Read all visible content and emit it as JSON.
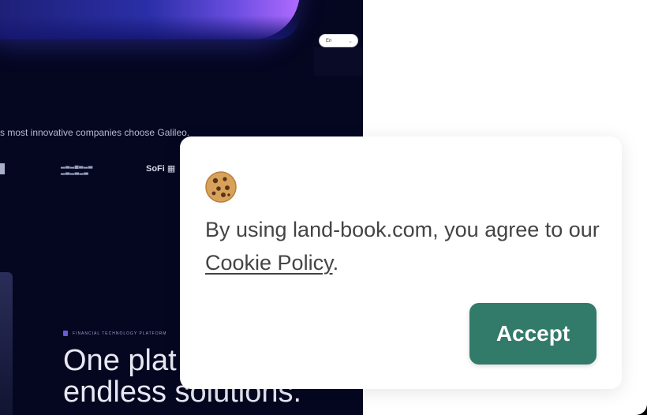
{
  "background_preview": {
    "language": "En",
    "tagline": "s most innovative companies choose Galileo.",
    "logos": [
      "SoFi"
    ],
    "kicker": "FINANCIAL TECHNOLOGY PLATFORM",
    "headline_line1": "One plat",
    "headline_line2": "endless solutions."
  },
  "cookie_banner": {
    "icon": "cookie-icon",
    "text_before": "By using land-book.com, you agree to our ",
    "policy_link": "Cookie Policy",
    "text_after": ".",
    "accept_label": "Accept",
    "accent_color": "#327a6a"
  }
}
